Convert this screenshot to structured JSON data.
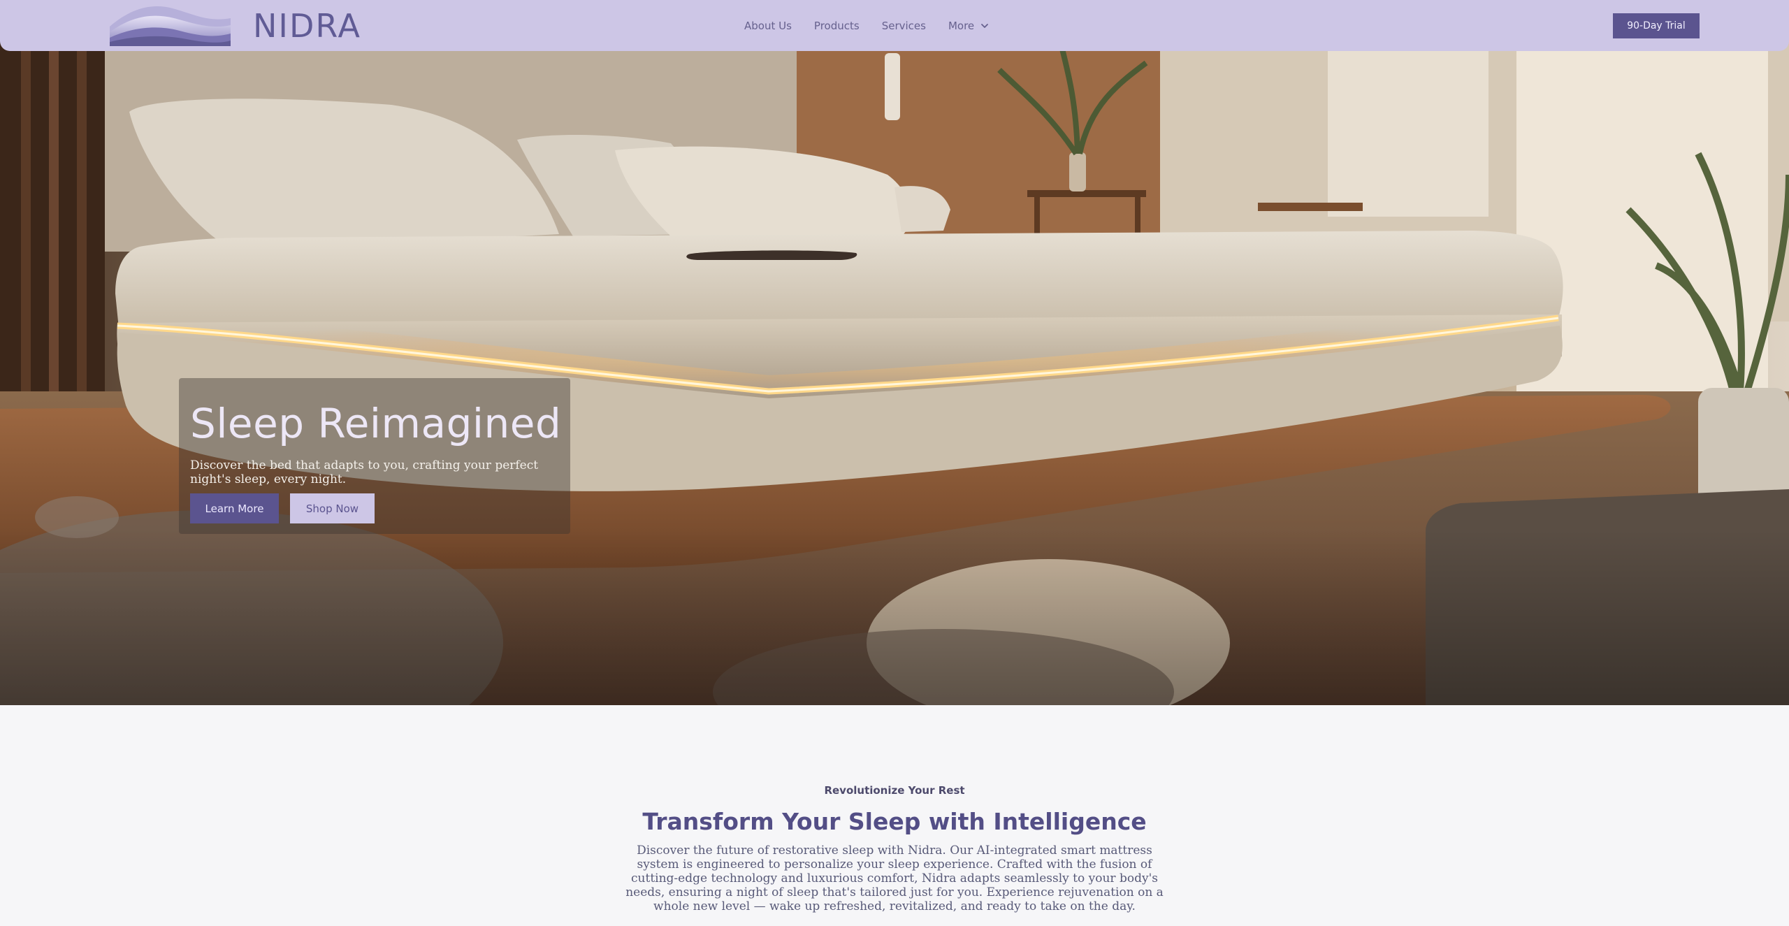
{
  "brand": {
    "name": "NIDRA"
  },
  "nav": {
    "items": [
      {
        "label": "About Us"
      },
      {
        "label": "Products"
      },
      {
        "label": "Services"
      },
      {
        "label": "More"
      }
    ],
    "trial_label": "90-Day Trial"
  },
  "hero": {
    "title": "Sleep Reimagined",
    "subtitle": "Discover the bed that adapts to you, crafting your perfect night's sleep, every night.",
    "learn_more_label": "Learn More",
    "shop_now_label": "Shop Now"
  },
  "intro": {
    "eyebrow": "Revolutionize Your Rest",
    "title": "Transform Your Sleep with Intelligence",
    "body": "Discover the future of restorative sleep with Nidra. Our AI-integrated smart mattress system is engineered to personalize your sleep experience. Crafted with the fusion of cutting-edge technology and luxurious comfort, Nidra adapts seamlessly to your body's needs, ensuring a night of sleep that's tailored just for you. Experience rejuvenation on a whole new level — wake up refreshed, revitalized, and ready to take on the day."
  },
  "colors": {
    "header_bg": "#cdc6e6",
    "accent": "#5b548f",
    "page_bg": "#f6f6f8"
  }
}
